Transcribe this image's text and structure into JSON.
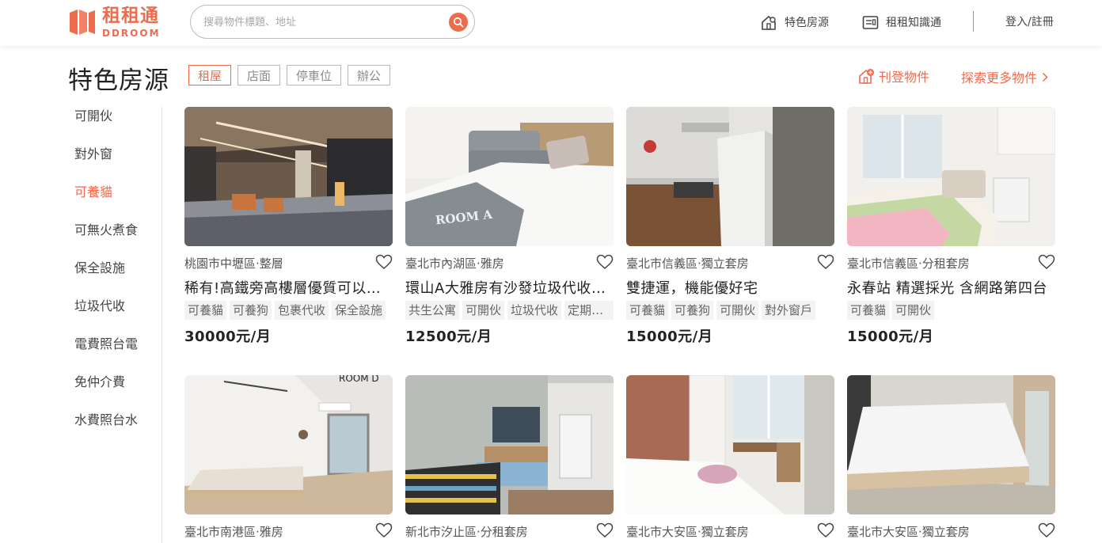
{
  "brand": {
    "name_cn": "租租通",
    "name_en": "DDROOM",
    "accent": "#ee6c4d"
  },
  "search": {
    "placeholder": "搜尋物件標題、地址",
    "value": ""
  },
  "nav": {
    "featured": {
      "label": "特色房源",
      "icon": "house-icon"
    },
    "knowledge": {
      "label": "租租知識通",
      "icon": "news-icon"
    },
    "login": "登入/註冊"
  },
  "page": {
    "title": "特色房源",
    "tabs": [
      {
        "label": "租屋",
        "active": true
      },
      {
        "label": "店面",
        "active": false
      },
      {
        "label": "停車位",
        "active": false
      },
      {
        "label": "辦公",
        "active": false
      }
    ],
    "publish_label": "刊登物件",
    "explore_label": "探索更多物件"
  },
  "sidebar": {
    "items": [
      {
        "label": "可開伙",
        "active": false
      },
      {
        "label": "對外窗",
        "active": false
      },
      {
        "label": "可養貓",
        "active": true
      },
      {
        "label": "可無火煮食",
        "active": false
      },
      {
        "label": "保全設施",
        "active": false
      },
      {
        "label": "垃圾代收",
        "active": false
      },
      {
        "label": "電費照台電",
        "active": false
      },
      {
        "label": "免仲介費",
        "active": false
      },
      {
        "label": "水費照台水",
        "active": false
      }
    ]
  },
  "listings": [
    {
      "location": "桃園市中壢區·整層",
      "title": "稀有!高鐵旁高樓層優質可以寵物",
      "tags": [
        "可養貓",
        "可養狗",
        "包裹代收",
        "保全設施"
      ],
      "price": "30000元/月",
      "photo": "lobby"
    },
    {
      "location": "臺北市內湖區·雅房",
      "title": "環山A大雅房有沙發垃圾代收可養寵物",
      "tags": [
        "共生公寓",
        "可開伙",
        "垃圾代收",
        "定期清潔"
      ],
      "price": "12500元/月",
      "photo": "bedroom-sofa"
    },
    {
      "location": "臺北市信義區·獨立套房",
      "title": "雙捷運，機能優好宅",
      "tags": [
        "可養貓",
        "可養狗",
        "可開伙",
        "對外窗戶"
      ],
      "price": "15000元/月",
      "photo": "kitchen"
    },
    {
      "location": "臺北市信義區·分租套房",
      "title": "永春站 精選採光 含網路第四台",
      "tags": [
        "可養貓",
        "可開伙"
      ],
      "price": "15000元/月",
      "photo": "bright-room"
    },
    {
      "location": "臺北市南港區·雅房",
      "title": "",
      "tags": [],
      "price": "",
      "photo": "room-d"
    },
    {
      "location": "新北市汐止區·分租套房",
      "title": "",
      "tags": [],
      "price": "",
      "photo": "suite-bath"
    },
    {
      "location": "臺北市大安區·獨立套房",
      "title": "",
      "tags": [],
      "price": "",
      "photo": "brick-room"
    },
    {
      "location": "臺北市大安區·獨立套房",
      "title": "",
      "tags": [],
      "price": "",
      "photo": "mattress"
    }
  ]
}
